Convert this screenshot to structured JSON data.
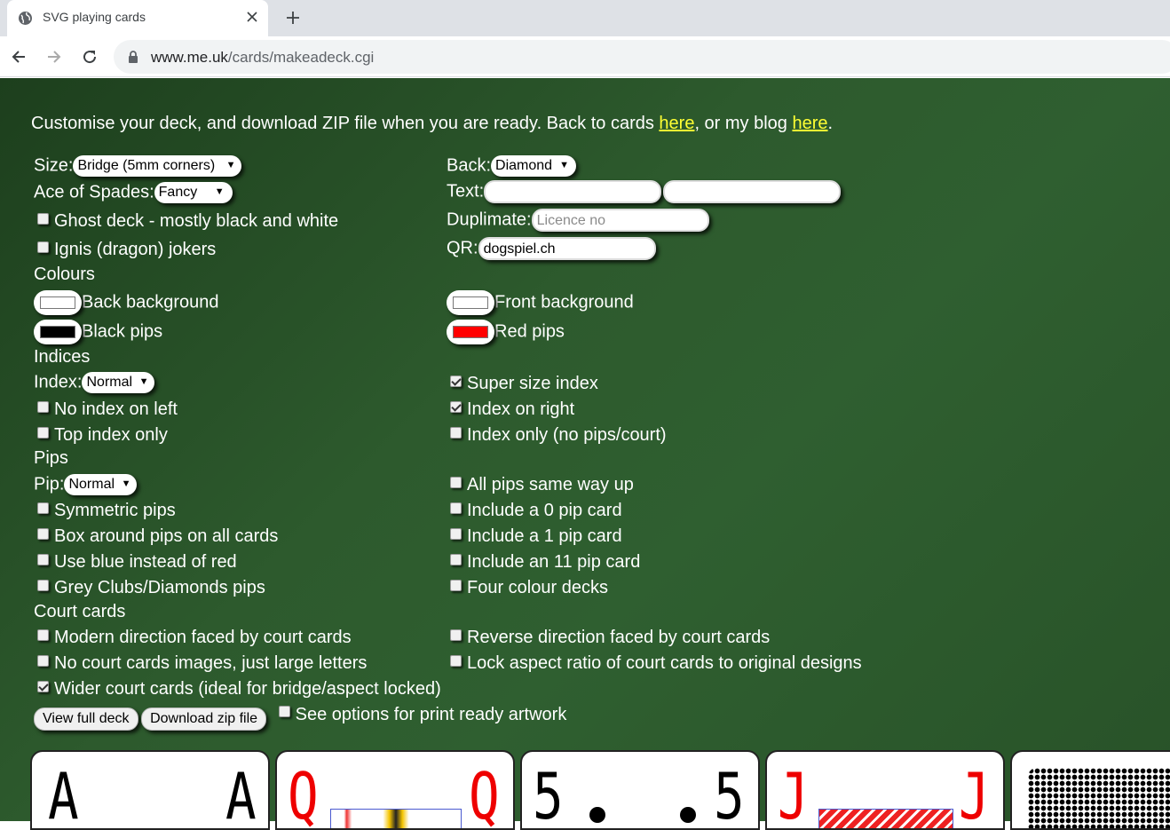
{
  "browser": {
    "tab_title": "SVG playing cards",
    "url_host": "www.me.uk",
    "url_path": "/cards/makeadeck.cgi"
  },
  "intro": {
    "text_before": "Customise your deck, and download ZIP file when you are ready. Back to cards ",
    "link1": "here",
    "text_middle": ", or my blog ",
    "link2": "here",
    "text_after": "."
  },
  "left": {
    "size_label": "Size:",
    "size_value": "Bridge (5mm corners)",
    "ace_label": "Ace of Spades:",
    "ace_value": "Fancy",
    "ghost_label": "Ghost deck - mostly black and white",
    "ignis_label": "Ignis (dragon) jokers"
  },
  "right": {
    "back_label": "Back:",
    "back_value": "Diamond",
    "text_label": "Text:",
    "text1_value": "",
    "text2_value": "",
    "duplimate_label": "Duplimate:",
    "duplimate_placeholder": "Licence no",
    "qr_label": "QR:",
    "qr_value": "dogspiel.ch"
  },
  "colours": {
    "heading": "Colours",
    "back_bg_label": "Back background",
    "black_pips_label": "Black pips",
    "front_bg_label": "Front background",
    "red_pips_label": "Red pips",
    "back_bg_color": "#ffffff",
    "black_pips_color": "#000000",
    "front_bg_color": "#ffffff",
    "red_pips_color": "#ff0000"
  },
  "indices": {
    "heading": "Indices",
    "index_label": "Index:",
    "index_value": "Normal",
    "no_index_left": "No index on left",
    "top_index_only": "Top index only",
    "super_size": "Super size index",
    "index_right": "Index on right",
    "index_only": "Index only (no pips/court)"
  },
  "pips": {
    "heading": "Pips",
    "pip_label": "Pip:",
    "pip_value": "Normal",
    "symmetric": "Symmetric pips",
    "box_around": "Box around pips on all cards",
    "blue_red": "Use blue instead of red",
    "grey_clubs": "Grey Clubs/Diamonds pips",
    "same_way": "All pips same way up",
    "zero_pip": "Include a 0 pip card",
    "one_pip": "Include a 1 pip card",
    "eleven_pip": "Include an 11 pip card",
    "four_colour": "Four colour decks"
  },
  "court": {
    "heading": "Court cards",
    "modern": "Modern direction faced by court cards",
    "no_images": "No court cards images, just large letters",
    "wider": "Wider court cards (ideal for bridge/aspect locked)",
    "reverse": "Reverse direction faced by court cards",
    "lock_aspect": "Lock aspect ratio of court cards to original designs"
  },
  "actions": {
    "view_full": "View full deck",
    "download": "Download zip file",
    "print_ready": "See options for print ready artwork"
  },
  "cards": {
    "c1": "A",
    "c2": "Q",
    "c3": "5",
    "c4": "J"
  }
}
